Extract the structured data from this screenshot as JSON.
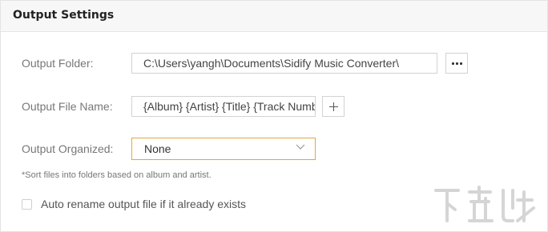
{
  "header": {
    "title": "Output Settings"
  },
  "output_folder": {
    "label": "Output Folder:",
    "value": "C:\\Users\\yangh\\Documents\\Sidify Music Converter\\",
    "browse_icon": "ellipsis-icon"
  },
  "output_file_name": {
    "label": "Output File Name:",
    "value": "{Album} {Artist} {Title} {Track Number}",
    "add_icon": "plus-icon"
  },
  "output_organized": {
    "label": "Output Organized:",
    "selected": "None",
    "accent_color": "#e0a93b",
    "hint": "*Sort files into folders based on album and artist."
  },
  "auto_rename": {
    "label": "Auto rename output file if it already exists",
    "checked": false
  },
  "watermark": {
    "text": "下载吧",
    "url": "www.xiazaiba.com"
  }
}
